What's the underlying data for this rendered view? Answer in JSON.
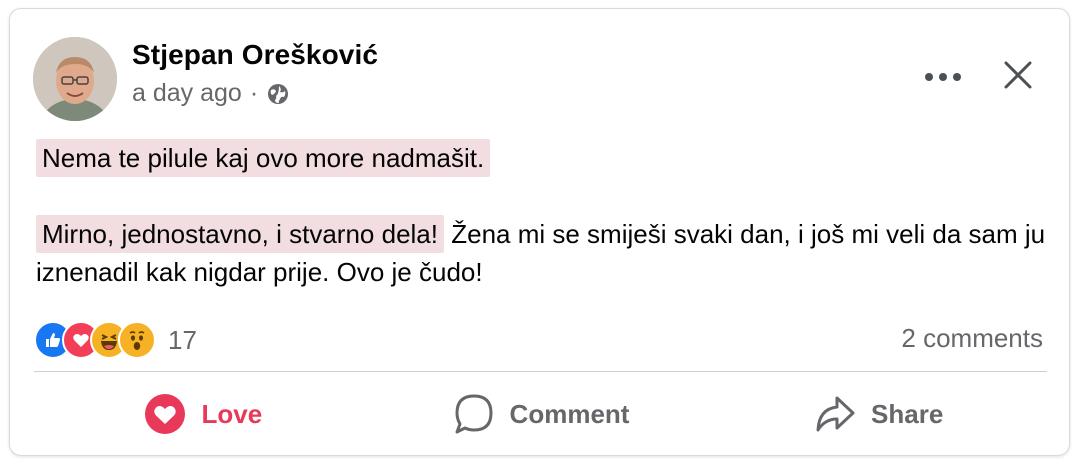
{
  "post": {
    "author": "Stjepan Orešković",
    "time": "a day ago",
    "separator": "·",
    "privacy_icon": "globe-icon",
    "paragraphs": [
      {
        "highlight": "Nema te pilule kaj ovo more nadmašit.",
        "rest": ""
      },
      {
        "highlight": "Mirno, jednostavno, i stvarno dela!",
        "rest": " Žena mi se smiješi svaki dan, i još mi veli da sam ju iznenadil kak nigdar prije. Ovo je čudo!"
      }
    ]
  },
  "reactions": {
    "icons": [
      "like-icon",
      "love-icon",
      "haha-icon",
      "wow-icon"
    ],
    "count": "17"
  },
  "comments_count": "2 comments",
  "actions": {
    "love": "Love",
    "comment": "Comment",
    "share": "Share"
  },
  "colors": {
    "highlight": "#f2dde1",
    "love": "#e8395a",
    "like": "#1877f2",
    "muted": "#65676b"
  }
}
